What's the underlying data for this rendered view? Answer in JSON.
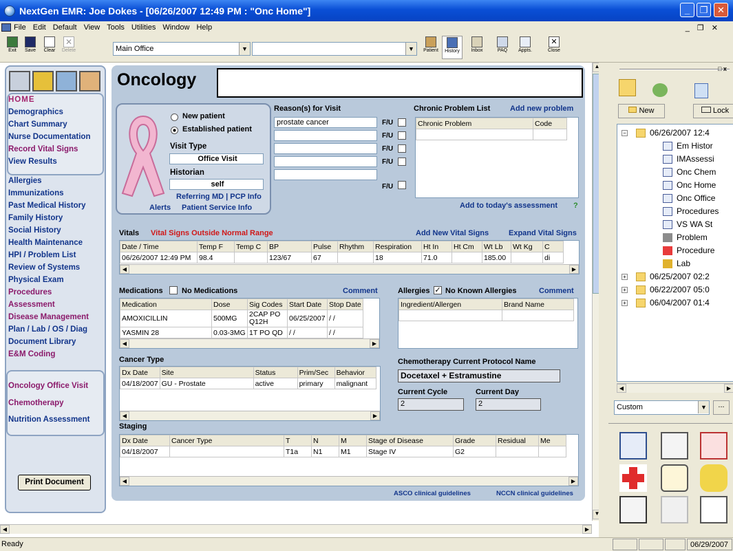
{
  "window": {
    "title": "NextGen EMR: Joe Dokes - [06/26/2007 12:49 PM : \"Onc Home\"]",
    "min": "_",
    "max": "❐",
    "close": "✕"
  },
  "menu": [
    "File",
    "Edit",
    "Default",
    "View",
    "Tools",
    "Utilities",
    "Window",
    "Help"
  ],
  "menu_right": "_ ❐ ✕",
  "toolbar": {
    "exit": "Exit",
    "save": "Save",
    "clear": "Clear",
    "delete": "Delete",
    "location": "Main Office",
    "patient": "Patient",
    "history": "History",
    "inbox": "Inbox",
    "pao": "PAQ",
    "appts": "Appts.",
    "close": "Close"
  },
  "nav": {
    "home": "HOME",
    "group1": [
      "Demographics",
      "Chart Summary",
      "Nurse Documentation",
      "Record Vital Signs",
      "View Results"
    ],
    "group2": [
      "Allergies",
      "Immunizations",
      "Past Medical History",
      "Family History",
      "Social History",
      "Health Maintenance",
      "HPI / Problem List",
      "Review of Systems",
      "Physical Exam",
      "Procedures",
      "Assessment",
      "Disease Management",
      "Plan / Lab / OS / Diag",
      "Document Library",
      "E&M Coding"
    ],
    "group3": [
      "Oncology Office Visit",
      "Chemotherapy",
      "Nutrition Assessment"
    ],
    "print": "Print Document"
  },
  "page": {
    "title": "Oncology",
    "new_patient": "New patient",
    "established_patient": "Established patient",
    "visit_type_label": "Visit Type",
    "visit_type": "Office Visit",
    "historian_label": "Historian",
    "historian": "self",
    "referring": "Referring MD | PCP Info",
    "alerts": "Alerts",
    "patient_service": "Patient Service Info",
    "reasons_label": "Reason(s) for Visit",
    "reasons": [
      "prostate cancer",
      "",
      "",
      "",
      ""
    ],
    "fu": "F/U",
    "chronic_label": "Chronic Problem List",
    "add_problem": "Add new problem",
    "chronic_cols": [
      "Chronic Problem",
      "Code"
    ],
    "add_assessment": "Add to today's assessment",
    "add_assessment_q": "?",
    "vitals_label": "Vitals",
    "vitals_warning": "Vital Signs Outside Normal Range",
    "add_vitals": "Add New Vital Signs",
    "expand_vitals": "Expand Vital Signs",
    "vitals_cols": [
      "Date / Time",
      "Temp F",
      "Temp C",
      "BP",
      "Pulse",
      "Rhythm",
      "Respiration",
      "Ht In",
      "Ht Cm",
      "Wt Lb",
      "Wt Kg",
      "C"
    ],
    "vitals_row": [
      "06/26/2007 12:49 PM",
      "98.4",
      "",
      "123/67",
      "67",
      "",
      "18",
      "71.0",
      "",
      "185.00",
      "",
      "di"
    ],
    "meds_label": "Medications",
    "no_meds": "No Medications",
    "comment": "Comment",
    "meds_cols": [
      "Medication",
      "Dose",
      "Sig Codes",
      "Start Date",
      "Stop Date"
    ],
    "meds_rows": [
      [
        "AMOXICILLIN",
        "500MG",
        "2CAP PO Q12H",
        "06/25/2007",
        "/ /"
      ],
      [
        "YASMIN 28",
        "0.03-3MG",
        "1T PO QD",
        "/ /",
        "/ /"
      ]
    ],
    "allergies_label": "Allergies",
    "no_allergies": "No Known Allergies",
    "allergy_cols": [
      "Ingredient/Allergen",
      "Brand Name"
    ],
    "cancer_label": "Cancer Type",
    "cancer_cols": [
      "Dx Date",
      "Site",
      "Status",
      "Prim/Sec",
      "Behavior"
    ],
    "cancer_row": [
      "04/18/2007",
      "GU - Prostate",
      "active",
      "primary",
      "malignant"
    ],
    "chemo_label": "Chemotherapy Current Protocol Name",
    "chemo_protocol": "Docetaxel + Estramustine",
    "cycle_label": "Current Cycle",
    "cycle": "2",
    "day_label": "Current Day",
    "day": "2",
    "staging_label": "Staging",
    "staging_cols": [
      "Dx Date",
      "Cancer Type",
      "T",
      "N",
      "M",
      "Stage of Disease",
      "Grade",
      "Residual",
      "Me"
    ],
    "staging_row": [
      "04/18/2007",
      "",
      "T1a",
      "N1",
      "M1",
      "Stage IV",
      "G2",
      "",
      ""
    ],
    "asco": "ASCO clinical guidelines",
    "nccn": "NCCN clinical guidelines"
  },
  "right": {
    "new": "New",
    "lock": "Lock",
    "tree": [
      {
        "label": "06/26/2007 12:4",
        "type": "folder",
        "level": 0,
        "exp": "−"
      },
      {
        "label": "Em Histor",
        "type": "doc",
        "level": 1
      },
      {
        "label": "IMAssessi",
        "type": "doc",
        "level": 1
      },
      {
        "label": "Onc Chem",
        "type": "doc",
        "level": 1
      },
      {
        "label": "Onc Home",
        "type": "doc",
        "level": 1
      },
      {
        "label": "Onc Office",
        "type": "doc",
        "level": 1
      },
      {
        "label": "Procedures",
        "type": "doc",
        "level": 1
      },
      {
        "label": "VS WA St",
        "type": "doc",
        "level": 1
      },
      {
        "label": "Problem",
        "type": "doc",
        "level": 1
      },
      {
        "label": "Procedure",
        "type": "doc",
        "level": 1
      },
      {
        "label": "Lab",
        "type": "doc",
        "level": 1
      },
      {
        "label": "06/25/2007 02:2",
        "type": "folder",
        "level": 0,
        "exp": "+"
      },
      {
        "label": "06/22/2007 05:0",
        "type": "folder",
        "level": 0,
        "exp": "+"
      },
      {
        "label": "06/04/2007 01:4",
        "type": "folder",
        "level": 0,
        "exp": "+"
      }
    ],
    "custom": "Custom",
    "ellipsis": "..."
  },
  "status": {
    "ready": "Ready",
    "date": "06/29/2007"
  }
}
